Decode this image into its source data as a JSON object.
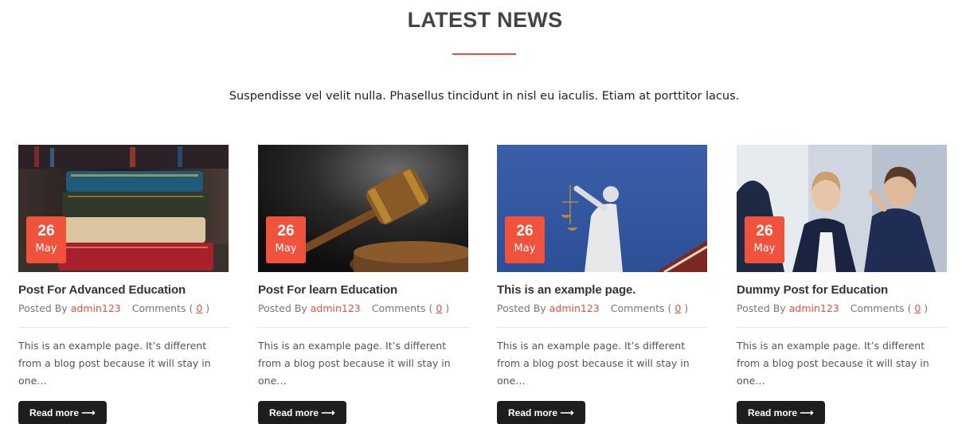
{
  "section": {
    "title": "LATEST NEWS",
    "subtitle": "Suspendisse vel velit nulla. Phasellus tincidunt in nisl eu iaculis. Etiam at porttitor lacus."
  },
  "colors": {
    "accent": "#f0523c",
    "button": "#1e1e1e"
  },
  "posts": [
    {
      "image": "books-image",
      "day": "26",
      "month": "May",
      "title": "Post For Advanced Education",
      "posted_by_label": "Posted By",
      "author": "admin123",
      "comments_label": "Comments (",
      "comments_count": "0",
      "comments_close": ")",
      "excerpt": "This is an example page. It’s different from a blog post because it will stay in one…",
      "read_more": "Read more ⟶"
    },
    {
      "image": "gavel-image",
      "day": "26",
      "month": "May",
      "title": "Post For learn Education",
      "posted_by_label": "Posted By",
      "author": "admin123",
      "comments_label": "Comments (",
      "comments_count": "0",
      "comments_close": ")",
      "excerpt": "This is an example page. It’s different from a blog post because it will stay in one…",
      "read_more": "Read more ⟶"
    },
    {
      "image": "justice-statue-image",
      "day": "26",
      "month": "May",
      "title": "This is an example page.",
      "posted_by_label": "Posted By",
      "author": "admin123",
      "comments_label": "Comments (",
      "comments_count": "0",
      "comments_close": ")",
      "excerpt": "This is an example page. It’s different from a blog post because it will stay in one…",
      "read_more": "Read more ⟶"
    },
    {
      "image": "business-women-image",
      "day": "26",
      "month": "May",
      "title": "Dummy Post for Education",
      "posted_by_label": "Posted By",
      "author": "admin123",
      "comments_label": "Comments (",
      "comments_count": "0",
      "comments_close": ")",
      "excerpt": "This is an example page. It’s different from a blog post because it will stay in one…",
      "read_more": "Read more ⟶"
    }
  ]
}
